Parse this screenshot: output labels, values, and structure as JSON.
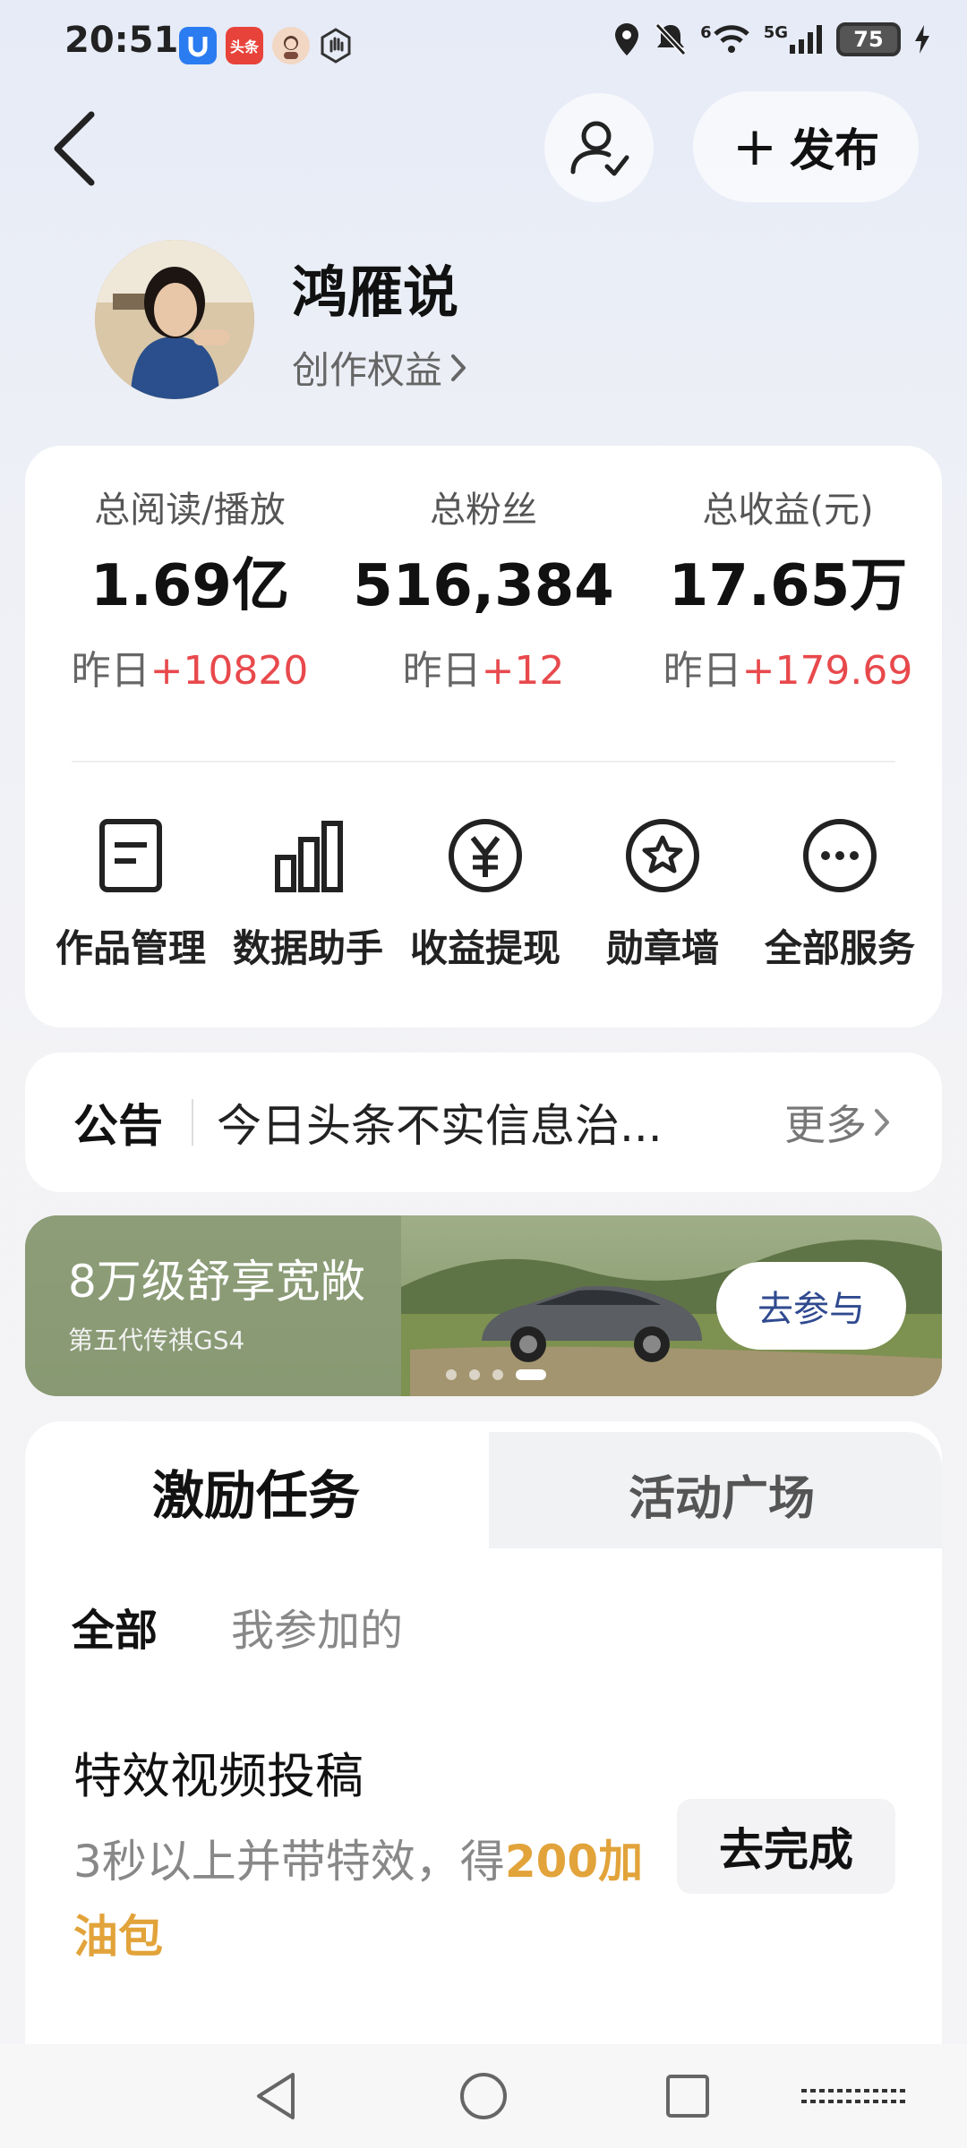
{
  "status_bar": {
    "time": "20:51",
    "app_icons": [
      "u-app-icon",
      "toutiao-app-icon",
      "avatar-app-icon",
      "hand-app-icon"
    ],
    "toutiao_label": "头条",
    "network": "5G",
    "signal_mark": "6",
    "battery": "75"
  },
  "header": {
    "back_icon": "chevron-left-icon",
    "follow_icon": "user-check-icon",
    "publish_label": "发布"
  },
  "profile": {
    "name": "鸿雁说",
    "rights_label": "创作权益"
  },
  "stats": [
    {
      "label": "总阅读/播放",
      "value": "1.69亿",
      "delta_prefix": "昨日",
      "delta": "+10820"
    },
    {
      "label": "总粉丝",
      "value": "516,384",
      "delta_prefix": "昨日",
      "delta": "+12"
    },
    {
      "label": "总收益(元)",
      "value": "17.65万",
      "delta_prefix": "昨日",
      "delta": "+179.69"
    }
  ],
  "services": [
    {
      "label": "作品管理",
      "icon": "document-icon"
    },
    {
      "label": "数据助手",
      "icon": "bar-chart-icon"
    },
    {
      "label": "收益提现",
      "icon": "yuan-icon"
    },
    {
      "label": "勋章墙",
      "icon": "medal-icon"
    },
    {
      "label": "全部服务",
      "icon": "more-icon"
    }
  ],
  "notice": {
    "tag": "公告",
    "text": "今日头条不实信息治...",
    "more": "更多"
  },
  "banner": {
    "title": "8万级舒享宽敞",
    "subtitle": "第五代传祺GS4",
    "button": "去参与",
    "page_count": 4,
    "active_page": 4,
    "colors": {
      "sky": "#8ea27c",
      "field": "#7b8f52"
    }
  },
  "tasks": {
    "tabs": [
      "激励任务",
      "活动广场"
    ],
    "active_tab": "激励任务",
    "filters": [
      "全部",
      "我参加的"
    ],
    "active_filter": "全部",
    "item": {
      "title": "特效视频投稿",
      "desc_prefix": "3秒以上并带特效，得",
      "desc_highlight": "200加油包",
      "button": "去完成"
    }
  },
  "nav_bar": {
    "icons": [
      "back-triangle-icon",
      "home-circle-icon",
      "recents-square-icon"
    ]
  },
  "colors": {
    "accent_red": "#e8494c",
    "gold": "#e2a33a",
    "banner_button_text": "#2f4a8f"
  }
}
